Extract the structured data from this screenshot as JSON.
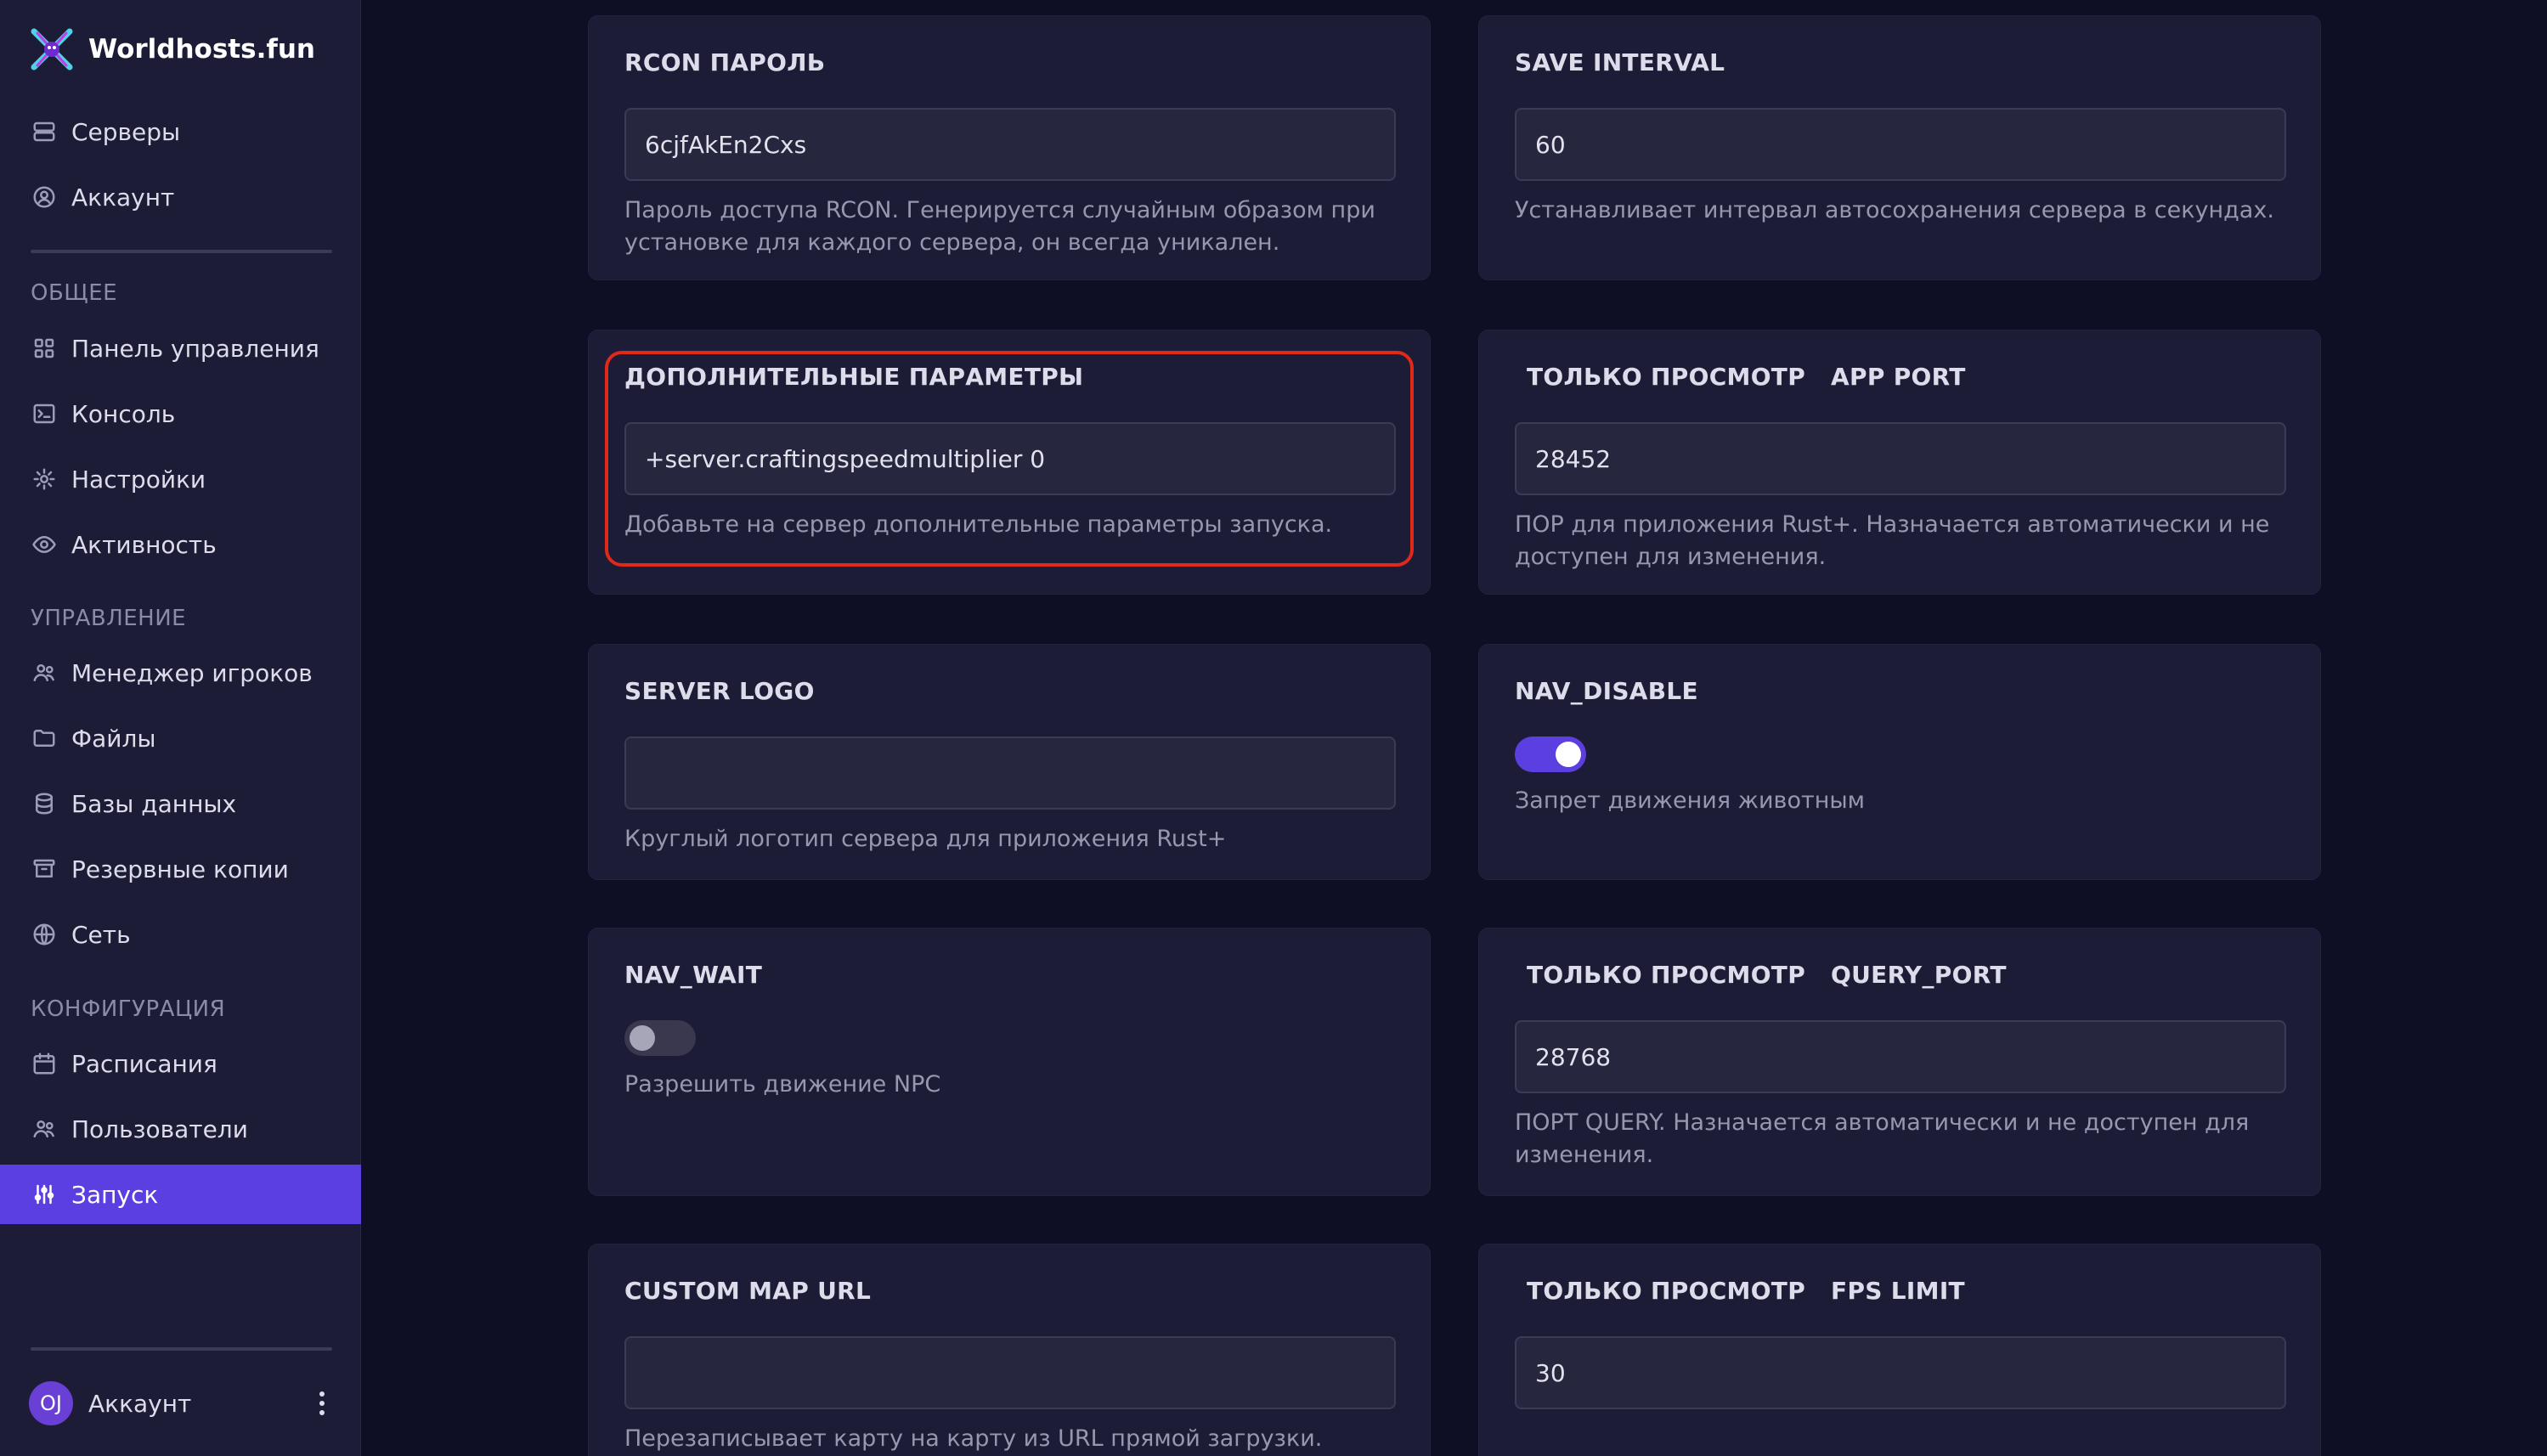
{
  "brand": {
    "name": "Worldhosts.fun",
    "logo_icon": "crossed-x-logo"
  },
  "nav_top": [
    {
      "label": "Серверы",
      "icon": "server-icon"
    },
    {
      "label": "Аккаунт",
      "icon": "user-circle-icon"
    }
  ],
  "sections": {
    "general": "ОБЩЕЕ",
    "management": "УПРАВЛЕНИЕ",
    "configuration": "КОНФИГУРАЦИЯ"
  },
  "nav_general": [
    {
      "label": "Панель управления",
      "icon": "grid-icon"
    },
    {
      "label": "Консоль",
      "icon": "terminal-icon"
    },
    {
      "label": "Настройки",
      "icon": "gear-icon"
    },
    {
      "label": "Активность",
      "icon": "eye-icon"
    }
  ],
  "nav_management": [
    {
      "label": "Менеджер игроков",
      "icon": "users-icon"
    },
    {
      "label": "Файлы",
      "icon": "folder-icon"
    },
    {
      "label": "Базы данных",
      "icon": "database-icon"
    },
    {
      "label": "Резервные копии",
      "icon": "archive-icon"
    },
    {
      "label": "Сеть",
      "icon": "globe-icon"
    }
  ],
  "nav_configuration": [
    {
      "label": "Расписания",
      "icon": "calendar-icon"
    },
    {
      "label": "Пользователи",
      "icon": "users-icon"
    },
    {
      "label": "Запуск",
      "icon": "sliders-icon",
      "active": true
    }
  ],
  "account": {
    "initials": "OJ",
    "label": "Аккаунт"
  },
  "readonly_label": "ТОЛЬКО ПРОСМОТР",
  "cards": {
    "rcon_password": {
      "title": "RCON ПАРОЛЬ",
      "value": "6cjfAkEn2Cxs",
      "description": "Пароль доступа RCON. Генерируется случайным образом при установке для каждого сервера, он всегда уникален."
    },
    "save_interval": {
      "title": "SAVE INTERVAL",
      "value": "60",
      "description": "Устанавливает интервал автосохранения сервера в секундах."
    },
    "extra_params": {
      "title": "ДОПОЛНИТЕЛЬНЫЕ ПАРАМЕТРЫ",
      "value": "+server.craftingspeedmultiplier 0",
      "description": "Добавьте на сервер дополнительные параметры запуска."
    },
    "app_port": {
      "title": "APP PORT",
      "value": "28452",
      "description": "ПОР для приложения Rust+. Назначается автоматически и не доступен для изменения."
    },
    "server_logo": {
      "title": "SERVER LOGO",
      "value": "",
      "description": "Круглый логотип сервера для приложения Rust+"
    },
    "nav_disable": {
      "title": "NAV_DISABLE",
      "enabled": true,
      "description": "Запрет движения животным"
    },
    "nav_wait": {
      "title": "NAV_WAIT",
      "enabled": false,
      "description": "Разрешить движение NPC"
    },
    "query_port": {
      "title": "QUERY_PORT",
      "value": "28768",
      "description": "ПОРТ QUERY. Назначается автоматически и не доступен для изменения."
    },
    "custom_map_url": {
      "title": "CUSTOM MAP URL",
      "value": "",
      "description": "Перезаписывает карту на карту из URL прямой загрузки."
    },
    "fps_limit": {
      "title": "FPS LIMIT",
      "value": "30",
      "description": ""
    }
  },
  "colors": {
    "accent": "#5b3fe0",
    "highlight": "#e0291b",
    "background": "#0e0e25",
    "card": "#1d1c36"
  }
}
